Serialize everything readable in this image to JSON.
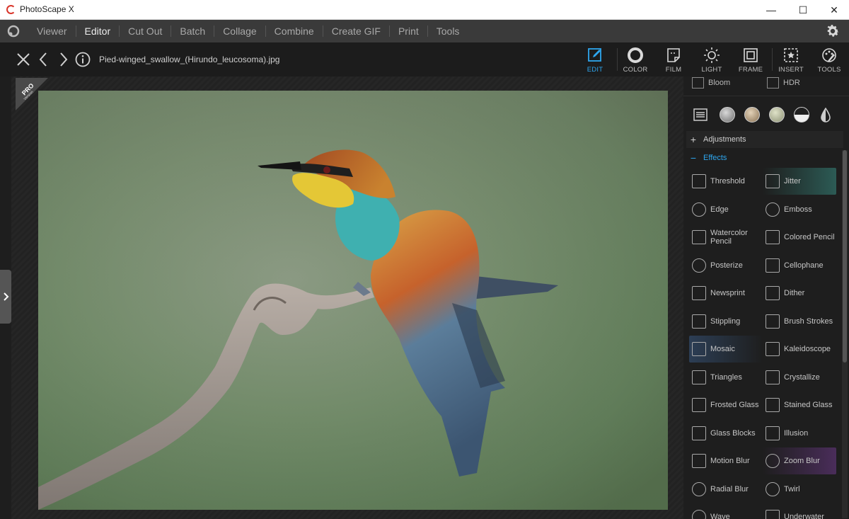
{
  "window": {
    "title": "PhotoScape X",
    "minimize_glyph": "—",
    "maximize_glyph": "☐",
    "close_glyph": "✕"
  },
  "menu": {
    "items": [
      {
        "label": "Viewer"
      },
      {
        "label": "Editor",
        "active": true
      },
      {
        "label": "Cut Out"
      },
      {
        "label": "Batch"
      },
      {
        "label": "Collage"
      },
      {
        "label": "Combine"
      },
      {
        "label": "Create GIF"
      },
      {
        "label": "Print"
      },
      {
        "label": "Tools"
      }
    ]
  },
  "toolbar": {
    "filename": "Pied-winged_swallow_(Hirundo_leucosoma).jpg",
    "tabs": [
      {
        "label": "EDIT",
        "icon": "edit-icon",
        "active": true
      },
      {
        "label": "COLOR",
        "icon": "color-icon"
      },
      {
        "label": "FILM",
        "icon": "film-icon"
      },
      {
        "label": "LIGHT",
        "icon": "light-icon"
      },
      {
        "label": "FRAME",
        "icon": "frame-icon"
      },
      {
        "label": "INSERT",
        "icon": "insert-icon"
      },
      {
        "label": "TOOLS",
        "icon": "tools-icon"
      }
    ]
  },
  "canvas": {
    "pro_badge": "PRO",
    "pro_badge_sub": "Version"
  },
  "panel": {
    "top_items": [
      {
        "label": "Bloom",
        "icon": "bloom-icon"
      },
      {
        "label": "HDR",
        "icon": "hdr-icon"
      }
    ],
    "sections": {
      "adjustments": {
        "label": "Adjustments",
        "symbol": "+"
      },
      "effects": {
        "label": "Effects",
        "symbol": "−"
      }
    },
    "effects": [
      {
        "label": "Threshold",
        "icon": "threshold-icon"
      },
      {
        "label": "Jitter",
        "icon": "jitter-icon"
      },
      {
        "label": "Edge",
        "icon": "edge-icon"
      },
      {
        "label": "Emboss",
        "icon": "emboss-icon"
      },
      {
        "label": "Watercolor Pencil",
        "icon": "watercolor-pencil-icon"
      },
      {
        "label": "Colored Pencil",
        "icon": "colored-pencil-icon"
      },
      {
        "label": "Posterize",
        "icon": "posterize-icon"
      },
      {
        "label": "Cellophane",
        "icon": "cellophane-icon"
      },
      {
        "label": "Newsprint",
        "icon": "newsprint-icon"
      },
      {
        "label": "Dither",
        "icon": "dither-icon"
      },
      {
        "label": "Stippling",
        "icon": "stippling-icon"
      },
      {
        "label": "Brush Strokes",
        "icon": "brush-strokes-icon"
      },
      {
        "label": "Mosaic",
        "icon": "mosaic-icon"
      },
      {
        "label": "Kaleidoscope",
        "icon": "kaleidoscope-icon"
      },
      {
        "label": "Triangles",
        "icon": "triangles-icon"
      },
      {
        "label": "Crystallize",
        "icon": "crystallize-icon"
      },
      {
        "label": "Frosted Glass",
        "icon": "frosted-glass-icon"
      },
      {
        "label": "Stained Glass",
        "icon": "stained-glass-icon"
      },
      {
        "label": "Glass Blocks",
        "icon": "glass-blocks-icon"
      },
      {
        "label": "Illusion",
        "icon": "illusion-icon"
      },
      {
        "label": "Motion Blur",
        "icon": "motion-blur-icon"
      },
      {
        "label": "Zoom Blur",
        "icon": "zoom-blur-icon"
      },
      {
        "label": "Radial Blur",
        "icon": "radial-blur-icon"
      },
      {
        "label": "Twirl",
        "icon": "twirl-icon"
      },
      {
        "label": "Wave",
        "icon": "wave-icon"
      },
      {
        "label": "Underwater",
        "icon": "underwater-icon"
      }
    ]
  },
  "colors": {
    "accent": "#2ea6ee",
    "menubar": "#3a3a3a",
    "toolbar": "#1c1c1c",
    "panel": "#1e1e1e"
  }
}
